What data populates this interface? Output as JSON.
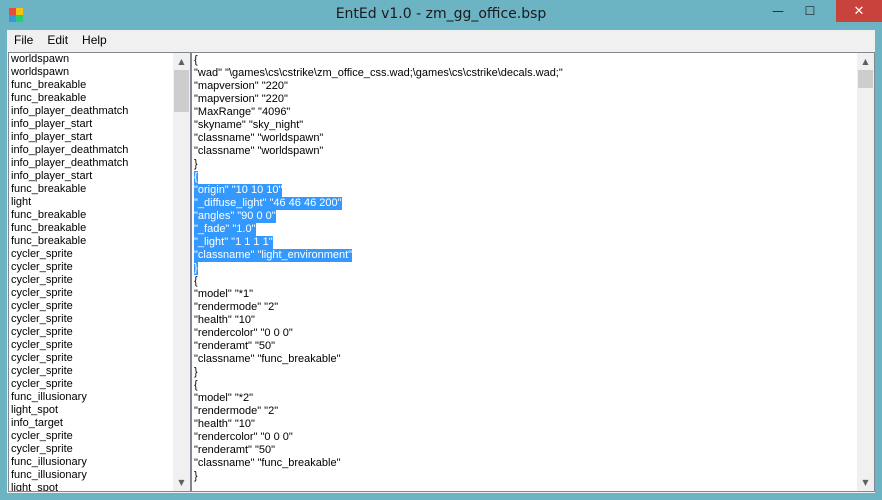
{
  "window": {
    "title": "EntEd v1.0 - zm_gg_office.bsp",
    "minimize_glyph": "—",
    "maximize_glyph": "☐",
    "close_glyph": "✕"
  },
  "menu": [
    "File",
    "Edit",
    "Help"
  ],
  "entity_list": [
    "worldspawn",
    "worldspawn",
    "func_breakable",
    "func_breakable",
    "info_player_deathmatch",
    "info_player_start",
    "info_player_start",
    "info_player_deathmatch",
    "info_player_deathmatch",
    "info_player_start",
    "func_breakable",
    "light",
    "func_breakable",
    "func_breakable",
    "func_breakable",
    "cycler_sprite",
    "cycler_sprite",
    "cycler_sprite",
    "cycler_sprite",
    "cycler_sprite",
    "cycler_sprite",
    "cycler_sprite",
    "cycler_sprite",
    "cycler_sprite",
    "cycler_sprite",
    "cycler_sprite",
    "func_illusionary",
    "light_spot",
    "info_target",
    "cycler_sprite",
    "cycler_sprite",
    "func_illusionary",
    "func_illusionary",
    "light_spot"
  ],
  "editor_lines": [
    {
      "text": "{",
      "selected": false
    },
    {
      "text": "\"wad\" \"\\games\\cs\\cstrike\\zm_office_css.wad;\\games\\cs\\cstrike\\decals.wad;\"",
      "selected": false
    },
    {
      "text": "\"mapversion\" \"220\"",
      "selected": false
    },
    {
      "text": "\"mapversion\" \"220\"",
      "selected": false
    },
    {
      "text": "\"MaxRange\" \"4096\"",
      "selected": false
    },
    {
      "text": "\"skyname\" \"sky_night\"",
      "selected": false
    },
    {
      "text": "\"classname\" \"worldspawn\"",
      "selected": false
    },
    {
      "text": "\"classname\" \"worldspawn\"",
      "selected": false
    },
    {
      "text": "}",
      "selected": false
    },
    {
      "text": "{",
      "selected": true
    },
    {
      "text": "\"origin\" \"10 10 10\"",
      "selected": true
    },
    {
      "text": "\"_diffuse_light\" \"46 46 46 200\"",
      "selected": true
    },
    {
      "text": "\"angles\" \"90 0 0\"",
      "selected": true
    },
    {
      "text": "\"_fade\" \"1.0\"",
      "selected": true
    },
    {
      "text": "\"_light\" \"1 1 1 1\"",
      "selected": true
    },
    {
      "text": "\"classname\" \"light_environment\"",
      "selected": true
    },
    {
      "text": "}",
      "selected": true
    },
    {
      "text": "{",
      "selected": false
    },
    {
      "text": "\"model\" \"*1\"",
      "selected": false
    },
    {
      "text": "\"rendermode\" \"2\"",
      "selected": false
    },
    {
      "text": "\"health\" \"10\"",
      "selected": false
    },
    {
      "text": "\"rendercolor\" \"0 0 0\"",
      "selected": false
    },
    {
      "text": "\"renderamt\" \"50\"",
      "selected": false
    },
    {
      "text": "\"classname\" \"func_breakable\"",
      "selected": false
    },
    {
      "text": "}",
      "selected": false
    },
    {
      "text": "{",
      "selected": false
    },
    {
      "text": "\"model\" \"*2\"",
      "selected": false
    },
    {
      "text": "\"rendermode\" \"2\"",
      "selected": false
    },
    {
      "text": "\"health\" \"10\"",
      "selected": false
    },
    {
      "text": "\"rendercolor\" \"0 0 0\"",
      "selected": false
    },
    {
      "text": "\"renderamt\" \"50\"",
      "selected": false
    },
    {
      "text": "\"classname\" \"func_breakable\"",
      "selected": false
    },
    {
      "text": "}",
      "selected": false
    }
  ],
  "colors": {
    "titlebar": "#6cb4c4",
    "close_button": "#c7433b",
    "selection": "#3399ff"
  },
  "icons": {
    "app": "app-icon",
    "scroll_up": "chevron-up-icon",
    "scroll_down": "chevron-down-icon"
  }
}
